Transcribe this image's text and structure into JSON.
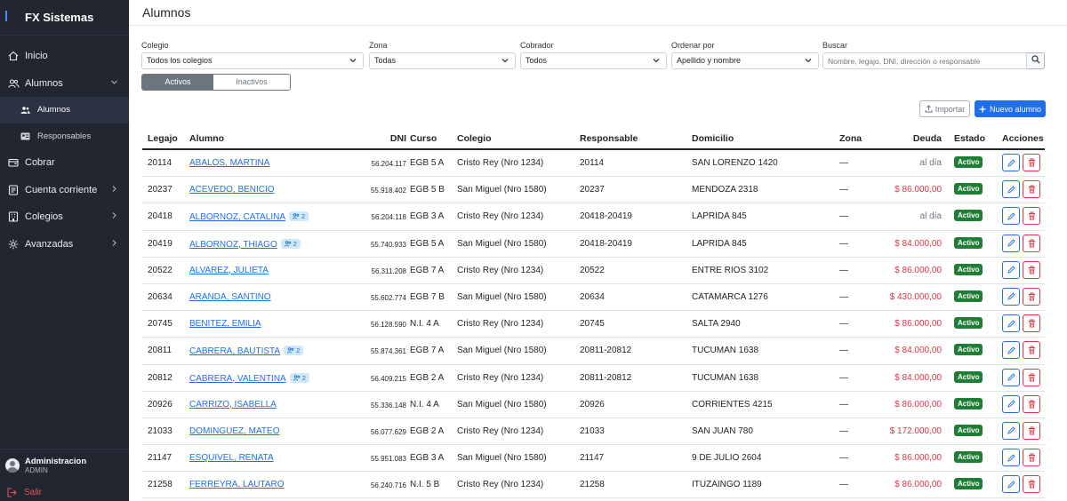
{
  "app": {
    "name": "FX Sistemas"
  },
  "nav": {
    "inicio": "Inicio",
    "alumnos": "Alumnos",
    "sub_alumnos": "Alumnos",
    "sub_responsables": "Responsables",
    "cobrar": "Cobrar",
    "cuenta_corriente": "Cuenta corriente",
    "colegios": "Colegios",
    "avanzadas": "Avanzadas"
  },
  "user": {
    "name": "Administracion",
    "role": "ADMIN",
    "logout": "Salir"
  },
  "page": {
    "title": "Alumnos"
  },
  "filters": {
    "colegio": {
      "label": "Colegio",
      "value": "Todos los colegios"
    },
    "zona": {
      "label": "Zona",
      "value": "Todas"
    },
    "cobrador": {
      "label": "Cobrador",
      "value": "Todos"
    },
    "orden": {
      "label": "Ordenar por",
      "value": "Apellido y nombre"
    },
    "buscar": {
      "label": "Buscar",
      "placeholder": "Nombre, legajo, DNI, dirección o responsable"
    }
  },
  "toggle": {
    "active": "Activos",
    "inactive": "Inactivos"
  },
  "actions": {
    "import": "Importar",
    "new": "Nuevo alumno"
  },
  "table": {
    "headers": {
      "legajo": "Legajo",
      "alumno": "Alumno",
      "dni": "DNI",
      "curso": "Curso",
      "colegio": "Colegio",
      "responsable": "Responsable",
      "domicilio": "Domicilio",
      "zona": "Zona",
      "deuda": "Deuda",
      "estado": "Estado",
      "acciones": "Acciones"
    },
    "rows": [
      {
        "legajo": "20114",
        "alumno": "ABALOS, MARTINA",
        "sib": "",
        "dni": "56.204.117",
        "curso": "EGB 5 A",
        "colegio": "Cristo Rey (Nro 1234)",
        "responsable": "20114",
        "domicilio": "SAN LORENZO 1420",
        "zona": "—",
        "deuda": "al día",
        "estado": "Activo"
      },
      {
        "legajo": "20237",
        "alumno": "ACEVEDO, BENICIO",
        "sib": "",
        "dni": "55.918.402",
        "curso": "EGB 5 B",
        "colegio": "San Miguel (Nro 1580)",
        "responsable": "20237",
        "domicilio": "MENDOZA 2318",
        "zona": "—",
        "deuda": "$ 86.000,00",
        "estado": "Activo"
      },
      {
        "legajo": "20418",
        "alumno": "ALBORNOZ, CATALINA",
        "sib": "2",
        "dni": "56.204.118",
        "curso": "EGB 3 A",
        "colegio": "Cristo Rey (Nro 1234)",
        "responsable": "20418-20419",
        "domicilio": "LAPRIDA 845",
        "zona": "—",
        "deuda": "al día",
        "estado": "Activo"
      },
      {
        "legajo": "20419",
        "alumno": "ALBORNOZ, THIAGO",
        "sib": "2",
        "dni": "55.740.933",
        "curso": "EGB 5 A",
        "colegio": "San Miguel (Nro 1580)",
        "responsable": "20418-20419",
        "domicilio": "LAPRIDA 845",
        "zona": "—",
        "deuda": "$ 84.000,00",
        "estado": "Activo"
      },
      {
        "legajo": "20522",
        "alumno": "ALVAREZ, JULIETA",
        "sib": "",
        "dni": "56.311.208",
        "curso": "EGB 7 A",
        "colegio": "Cristo Rey (Nro 1234)",
        "responsable": "20522",
        "domicilio": "ENTRE RIOS 3102",
        "zona": "—",
        "deuda": "$ 86.000,00",
        "estado": "Activo"
      },
      {
        "legajo": "20634",
        "alumno": "ARANDA, SANTINO",
        "sib": "",
        "dni": "55.602.774",
        "curso": "EGB 7 B",
        "colegio": "San Miguel (Nro 1580)",
        "responsable": "20634",
        "domicilio": "CATAMARCA 1276",
        "zona": "—",
        "deuda": "$ 430.000,00",
        "estado": "Activo"
      },
      {
        "legajo": "20745",
        "alumno": "BENITEZ, EMILIA",
        "sib": "",
        "dni": "56.128.590",
        "curso": "N.I. 4 A",
        "colegio": "Cristo Rey (Nro 1234)",
        "responsable": "20745",
        "domicilio": "SALTA 2940",
        "zona": "—",
        "deuda": "$ 86.000,00",
        "estado": "Activo"
      },
      {
        "legajo": "20811",
        "alumno": "CABRERA, BAUTISTA",
        "sib": "2",
        "dni": "55.874.361",
        "curso": "EGB 7 A",
        "colegio": "San Miguel (Nro 1580)",
        "responsable": "20811-20812",
        "domicilio": "TUCUMAN 1638",
        "zona": "—",
        "deuda": "$ 84.000,00",
        "estado": "Activo"
      },
      {
        "legajo": "20812",
        "alumno": "CABRERA, VALENTINA",
        "sib": "2",
        "dni": "56.409.215",
        "curso": "EGB 2 A",
        "colegio": "Cristo Rey (Nro 1234)",
        "responsable": "20811-20812",
        "domicilio": "TUCUMAN 1638",
        "zona": "—",
        "deuda": "$ 84.000,00",
        "estado": "Activo"
      },
      {
        "legajo": "20926",
        "alumno": "CARRIZO, ISABELLA",
        "sib": "",
        "dni": "55.336.148",
        "curso": "N.I. 4 A",
        "colegio": "San Miguel (Nro 1580)",
        "responsable": "20926",
        "domicilio": "CORRIENTES 4215",
        "zona": "—",
        "deuda": "$ 86.000,00",
        "estado": "Activo"
      },
      {
        "legajo": "21033",
        "alumno": "DOMINGUEZ, MATEO",
        "sib": "",
        "dni": "56.077.629",
        "curso": "EGB 2 A",
        "colegio": "Cristo Rey (Nro 1234)",
        "responsable": "21033",
        "domicilio": "SAN JUAN 780",
        "zona": "—",
        "deuda": "$ 172.000,00",
        "estado": "Activo"
      },
      {
        "legajo": "21147",
        "alumno": "ESQUIVEL, RENATA",
        "sib": "",
        "dni": "55.951.083",
        "curso": "EGB 3 A",
        "colegio": "San Miguel (Nro 1580)",
        "responsable": "21147",
        "domicilio": "9 DE JULIO 2604",
        "zona": "—",
        "deuda": "$ 86.000,00",
        "estado": "Activo"
      },
      {
        "legajo": "21258",
        "alumno": "FERREYRA, LAUTARO",
        "sib": "",
        "dni": "56.240.716",
        "curso": "N.I. 5 B",
        "colegio": "Cristo Rey (Nro 1234)",
        "responsable": "21258",
        "domicilio": "ITUZAINGO 1189",
        "zona": "—",
        "deuda": "$ 86.000,00",
        "estado": "Activo"
      }
    ]
  },
  "colors": {
    "sidebar": "#212631",
    "accent": "#1f6feb",
    "danger": "#dc3545",
    "success": "#1e7e34"
  },
  "icons": [
    "home-icon",
    "users-icon",
    "user-icon",
    "id-card-icon",
    "cash-icon",
    "ledger-icon",
    "school-icon",
    "sliders-icon",
    "chevron-icon",
    "search-icon",
    "upload-icon",
    "plus-icon",
    "pencil-icon",
    "trash-icon",
    "logout-icon"
  ]
}
